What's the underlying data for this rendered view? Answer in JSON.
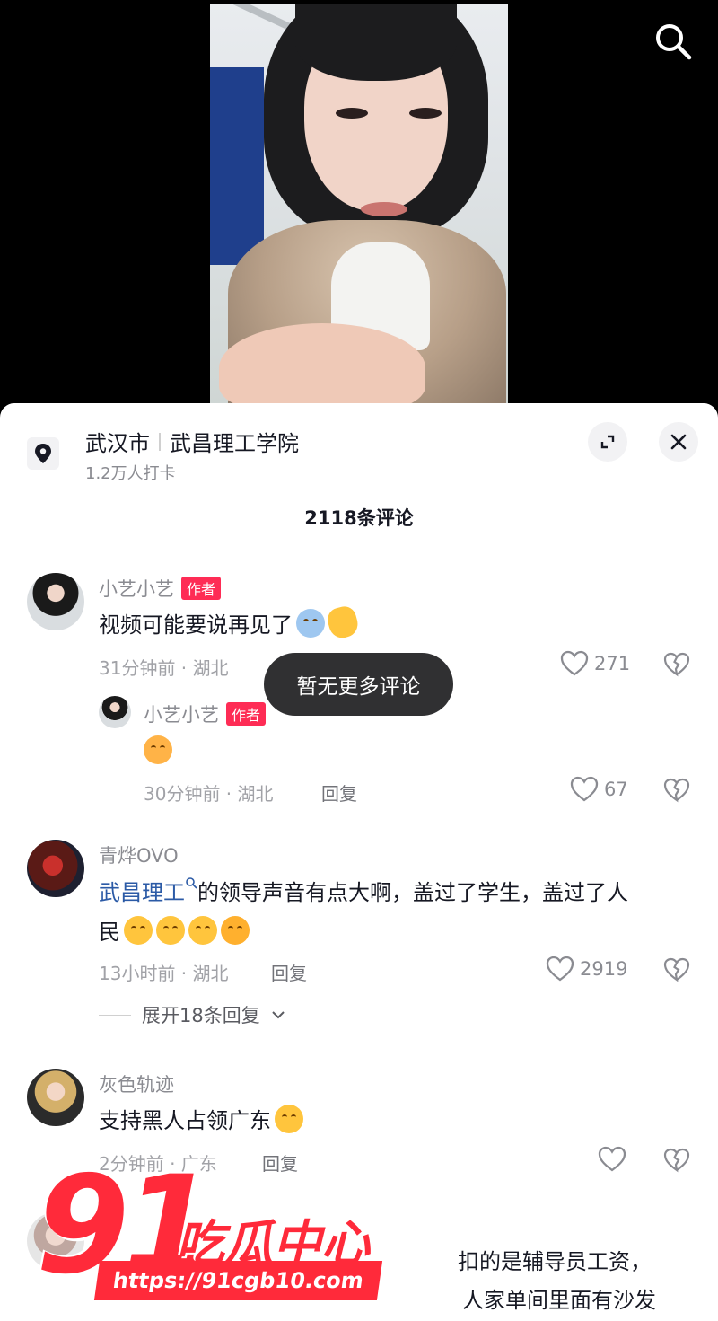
{
  "video": {
    "search_icon": "search-icon"
  },
  "location": {
    "city": "武汉市",
    "place": "武昌理工学院",
    "checkins": "1.2万人打卡",
    "pin_icon": "location-pin-icon"
  },
  "comment_count": "2118条评论",
  "toast": "暂无更多评论",
  "comments": [
    {
      "user": "小艺小艺",
      "tag": "作者",
      "text": "视频可能要说再见了",
      "time": "31分钟前 · 湖北",
      "likes": "271",
      "emojis": [
        "crying-emoji",
        "waving-hand-emoji"
      ]
    },
    {
      "user": "小艺小艺",
      "tag": "作者",
      "text": "",
      "time": "30分钟前 · 湖北",
      "reply": "回复",
      "likes": "67",
      "emojis": [
        "headband-emoji"
      ]
    },
    {
      "user": "青烨OVO",
      "link": "武昌理工",
      "text_line1": "的领导声音有点大啊，盖过了学生，盖过了人",
      "text_line2": "民",
      "time": "13小时前 · 湖北",
      "reply": "回复",
      "likes": "2919",
      "expand": "展开18条回复",
      "emojis": [
        "grin-emoji",
        "grin-emoji",
        "grin-emoji",
        "wink-emoji"
      ]
    },
    {
      "user": "灰色轨迹",
      "text": "支持黑人占领广东",
      "time": "2分钟前 · 广东",
      "reply": "回复",
      "likes": "",
      "emojis": [
        "dizzy-face-emoji"
      ]
    },
    {
      "text_line1": "扣的是辅导员工资，",
      "text_line2": "人家单间里面有沙发"
    }
  ],
  "watermark": {
    "number": "91",
    "name": "吃瓜中心",
    "url": "https://91cgb10.com"
  },
  "colors": {
    "accent": "#fe2c55",
    "link": "#2b5aa6",
    "watermark": "#ff2a3a"
  }
}
